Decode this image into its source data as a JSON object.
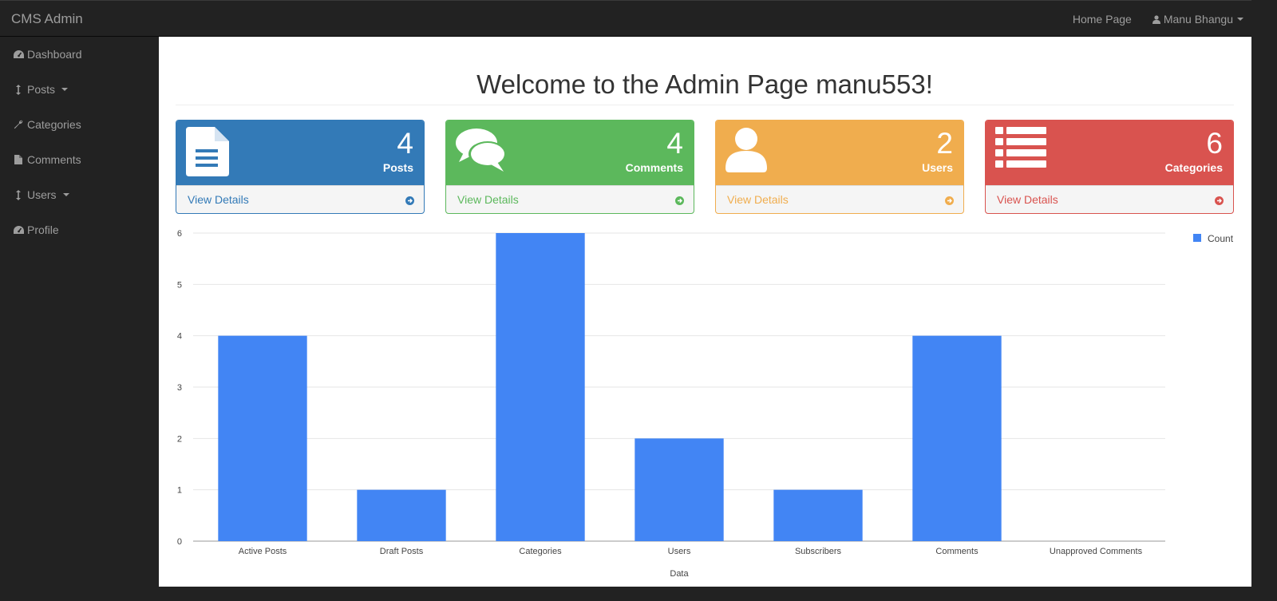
{
  "app": {
    "brand": "CMS Admin"
  },
  "topnav": {
    "home_label": "Home Page",
    "user_label": "Manu Bhangu"
  },
  "sidebar": {
    "items": [
      {
        "label": "Dashboard",
        "icon": "dashboard-icon",
        "has_caret": false
      },
      {
        "label": "Posts",
        "icon": "sort-arrows-icon",
        "has_caret": true
      },
      {
        "label": "Categories",
        "icon": "wrench-icon",
        "has_caret": false
      },
      {
        "label": "Comments",
        "icon": "file-icon",
        "has_caret": false
      },
      {
        "label": "Users",
        "icon": "sort-arrows-icon",
        "has_caret": true
      },
      {
        "label": "Profile",
        "icon": "dashboard-icon",
        "has_caret": false
      }
    ]
  },
  "header": {
    "title": "Welcome to the Admin Page manu553!"
  },
  "panels": [
    {
      "count": "4",
      "label": "Posts",
      "link": "View Details",
      "icon": "file-text-icon",
      "color": "#337ab7"
    },
    {
      "count": "4",
      "label": "Comments",
      "link": "View Details",
      "icon": "comments-icon",
      "color": "#5cb85c"
    },
    {
      "count": "2",
      "label": "Users",
      "link": "View Details",
      "icon": "user-icon",
      "color": "#f0ad4e"
    },
    {
      "count": "6",
      "label": "Categories",
      "link": "View Details",
      "icon": "list-icon",
      "color": "#d9534f"
    }
  ],
  "chart_data": {
    "type": "bar",
    "categories": [
      "Active Posts",
      "Draft Posts",
      "Categories",
      "Users",
      "Subscribers",
      "Comments",
      "Unapproved Comments"
    ],
    "series": [
      {
        "name": "Count",
        "values": [
          4,
          1,
          6,
          2,
          1,
          4,
          0
        ],
        "color": "#4285f4"
      }
    ],
    "xlabel": "Data",
    "ylabel": "",
    "ylim": [
      0,
      6
    ],
    "yticks": [
      0,
      1,
      2,
      3,
      4,
      5,
      6
    ],
    "grid": true,
    "legend": "top-right"
  }
}
